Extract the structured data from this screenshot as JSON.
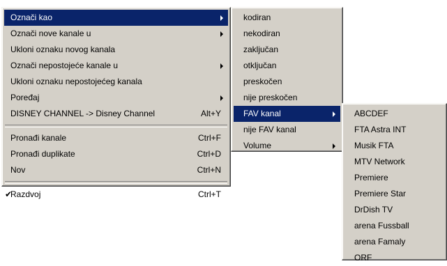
{
  "main_menu": {
    "items": [
      {
        "label": "Označi kao",
        "shortcut": "",
        "submenu": true,
        "selected": true
      },
      {
        "label": "Označi nove kanale u",
        "shortcut": "",
        "submenu": true
      },
      {
        "label": "Ukloni oznaku novog kanala",
        "shortcut": ""
      },
      {
        "label": "Označi nepostojeće kanale u",
        "shortcut": "",
        "submenu": true
      },
      {
        "label": "Ukloni oznaku nepostojećeg kanala",
        "shortcut": ""
      },
      {
        "label": "Poređaj",
        "shortcut": "",
        "submenu": true
      },
      {
        "label": "DISNEY CHANNEL -> Disney Channel",
        "shortcut": "Alt+Y"
      },
      {
        "label": "Pronađi kanale",
        "shortcut": "Ctrl+F"
      },
      {
        "label": "Pronađi duplikate",
        "shortcut": "Ctrl+D"
      },
      {
        "label": "Nov",
        "shortcut": "Ctrl+N"
      },
      {
        "label": "Razdvoj",
        "shortcut": "Ctrl+T",
        "checked": true,
        "check_glyph": "✔"
      }
    ]
  },
  "mark_as_menu": {
    "items": [
      {
        "label": "kodiran"
      },
      {
        "label": "nekodiran"
      },
      {
        "label": "zaključan"
      },
      {
        "label": "otključan"
      },
      {
        "label": "preskočen"
      },
      {
        "label": "nije preskočen"
      },
      {
        "label": "FAV kanal",
        "submenu": true,
        "selected": true
      },
      {
        "label": "nije FAV kanal"
      },
      {
        "label": "Volume",
        "submenu": true
      }
    ]
  },
  "fav_menu": {
    "items": [
      {
        "label": "ABCDEF"
      },
      {
        "label": "FTA Astra INT"
      },
      {
        "label": "Musik FTA"
      },
      {
        "label": "MTV Network"
      },
      {
        "label": "Premiere"
      },
      {
        "label": "Premiere Star"
      },
      {
        "label": "DrDish TV"
      },
      {
        "label": "arena Fussball"
      },
      {
        "label": "arena Famaly"
      },
      {
        "label": "ORF"
      }
    ]
  },
  "colors": {
    "menu_bg": "#d4d0c8",
    "highlight": "#0a246a",
    "highlight_text": "#ffffff"
  }
}
